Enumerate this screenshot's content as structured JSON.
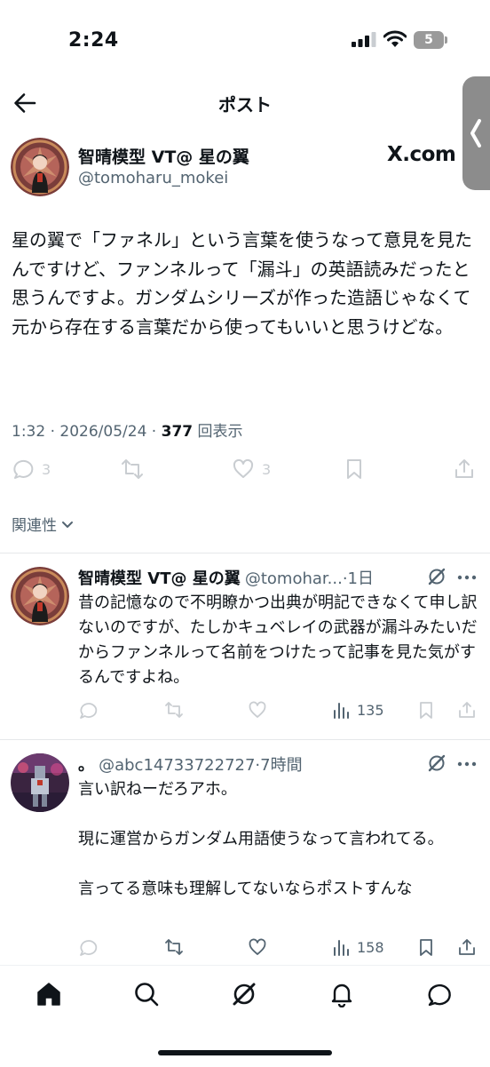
{
  "status_bar": {
    "time": "2:24",
    "battery": "5"
  },
  "header": {
    "title": "ポスト"
  },
  "main_post": {
    "name": "智晴模型 VT@ 星の翼",
    "handle": "@tomoharu_mokei",
    "watermark": "X.com",
    "text": "星の翼で「ファネル」という言葉を使うなって意見を見たんですけど、ファンネルって「漏斗」の英語読みだったと思うんですよ。ガンダムシリーズが作った造語じゃなくて元から存在する言葉だから使ってもいいと思うけどな。",
    "time": "1:32",
    "date": "2026/05/24",
    "views": "377",
    "views_label": "回表示",
    "replies": "3",
    "likes": "3"
  },
  "relevance_label": "関連性",
  "replies": [
    {
      "name": "智晴模型 VT@ 星の翼",
      "handle": "@tomohar...",
      "age": "1日",
      "text": "昔の記憶なので不明瞭かつ出典が明記できなくて申し訳ないのですが、たしかキュベレイの武器が漏斗みたいだからファンネルって名前をつけたって記事を見た気がするんですよね。",
      "views": "135"
    },
    {
      "name": "。",
      "handle": "@abc14733722727",
      "age": "7時間",
      "text_lines": [
        "言い訳ねーだろアホ。",
        "",
        "現に運営からガンダム用語使うなって言われてる。",
        "",
        "言ってる意味も理解してないならポストすんな"
      ],
      "views": "158"
    }
  ],
  "colors": {
    "text": "#0f1419",
    "muted": "#536471",
    "faded": "#c9cdd1",
    "divider": "#e6e8ea"
  }
}
